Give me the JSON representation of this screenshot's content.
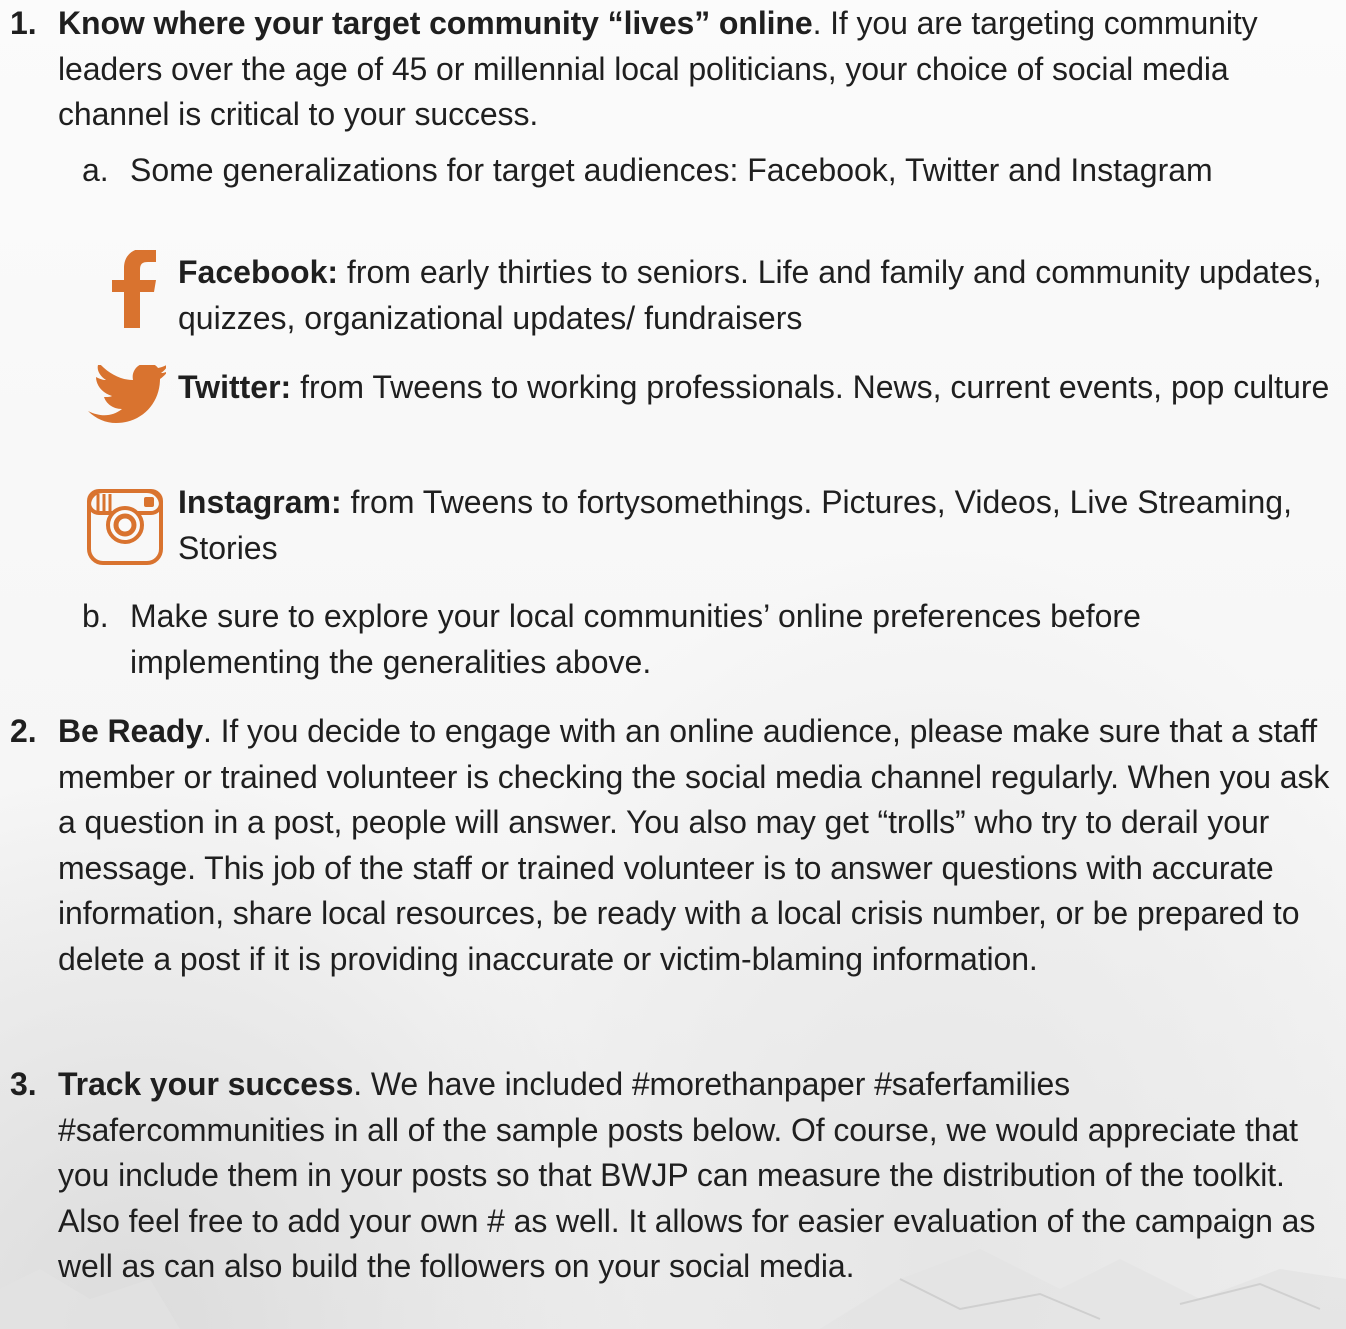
{
  "items": [
    {
      "number": "1.",
      "title": "Know where your target community “lives” online",
      "body": ". If you are targeting community leaders over the age of 45 or millennial local politicians, your choice of social media channel is critical to your success.",
      "subitems": [
        {
          "letter": "a.",
          "text": "Some generalizations for target audiences:  Facebook, Twitter and Instagram"
        },
        {
          "letter": "b.",
          "text": "Make sure to explore your local communities’ online preferences before implementing the generalities above."
        }
      ],
      "platforms": [
        {
          "icon": "facebook-icon",
          "name": "Facebook:",
          "text": " from early thirties to seniors. Life and family and community updates, quizzes, organizational updates/ fundraisers"
        },
        {
          "icon": "twitter-icon",
          "name": "Twitter:",
          "text": " from Tweens to working professionals. News, current events, pop culture"
        },
        {
          "icon": "instagram-icon",
          "name": "Instagram:",
          "text": " from Tweens to fortysomethings. Pictures, Videos, Live Streaming, Stories"
        }
      ]
    },
    {
      "number": "2.",
      "title": "Be Ready",
      "body": ". If you decide to engage with an online audience, please make sure that a staff member or trained volunteer is checking the social media channel regularly. When you ask a question in a post, people will answer. You also may get “trolls” who try to derail your message. This job of the staff or trained volunteer is to answer questions with accurate information, share local resources, be ready with a local crisis number, or be prepared to delete a post if it is providing inaccurate or victim-blaming information."
    },
    {
      "number": "3.",
      "title": "Track your success",
      "body": ". We have included #morethanpaper #saferfamilies #safercommunities in all of the sample posts below. Of course, we would appreciate that you include them in your posts so that BWJP can measure the distribution of the toolkit. Also feel free to add your own # as well. It allows for easier evaluation of the campaign as well as can also build the followers on your social media."
    }
  ],
  "colors": {
    "icon_orange": "#d9732f",
    "text": "#1f1f1f"
  }
}
